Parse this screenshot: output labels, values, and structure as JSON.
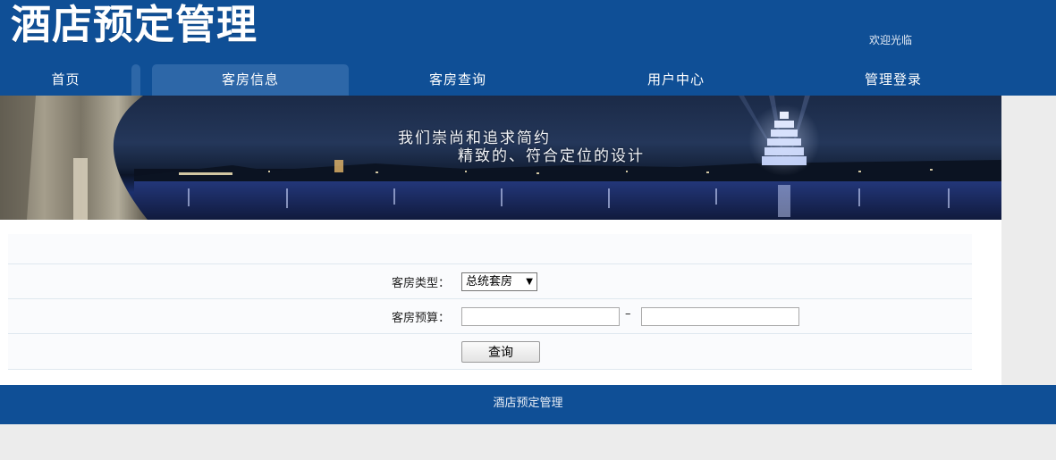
{
  "header": {
    "site_title": "酒店预定管理",
    "welcome": "欢迎光临"
  },
  "nav": {
    "items": [
      {
        "label": "首页"
      },
      {
        "label": "客房信息"
      },
      {
        "label": "客房查询"
      },
      {
        "label": "用户中心"
      },
      {
        "label": "管理登录"
      }
    ],
    "active_index": 1
  },
  "banner": {
    "line1": "我们崇尚和追求简约",
    "line2": "精致的、符合定位的设计"
  },
  "form": {
    "room_type_label": "客房类型：",
    "room_type_selected": "总统套房",
    "budget_label": "客房预算：",
    "budget_min_value": "",
    "budget_max_value": "",
    "range_separator": "–",
    "query_button_label": "查询"
  },
  "footer": {
    "text": "酒店预定管理"
  },
  "colors": {
    "brand_blue": "#0f4f96",
    "nav_active": "#2d67a8"
  }
}
